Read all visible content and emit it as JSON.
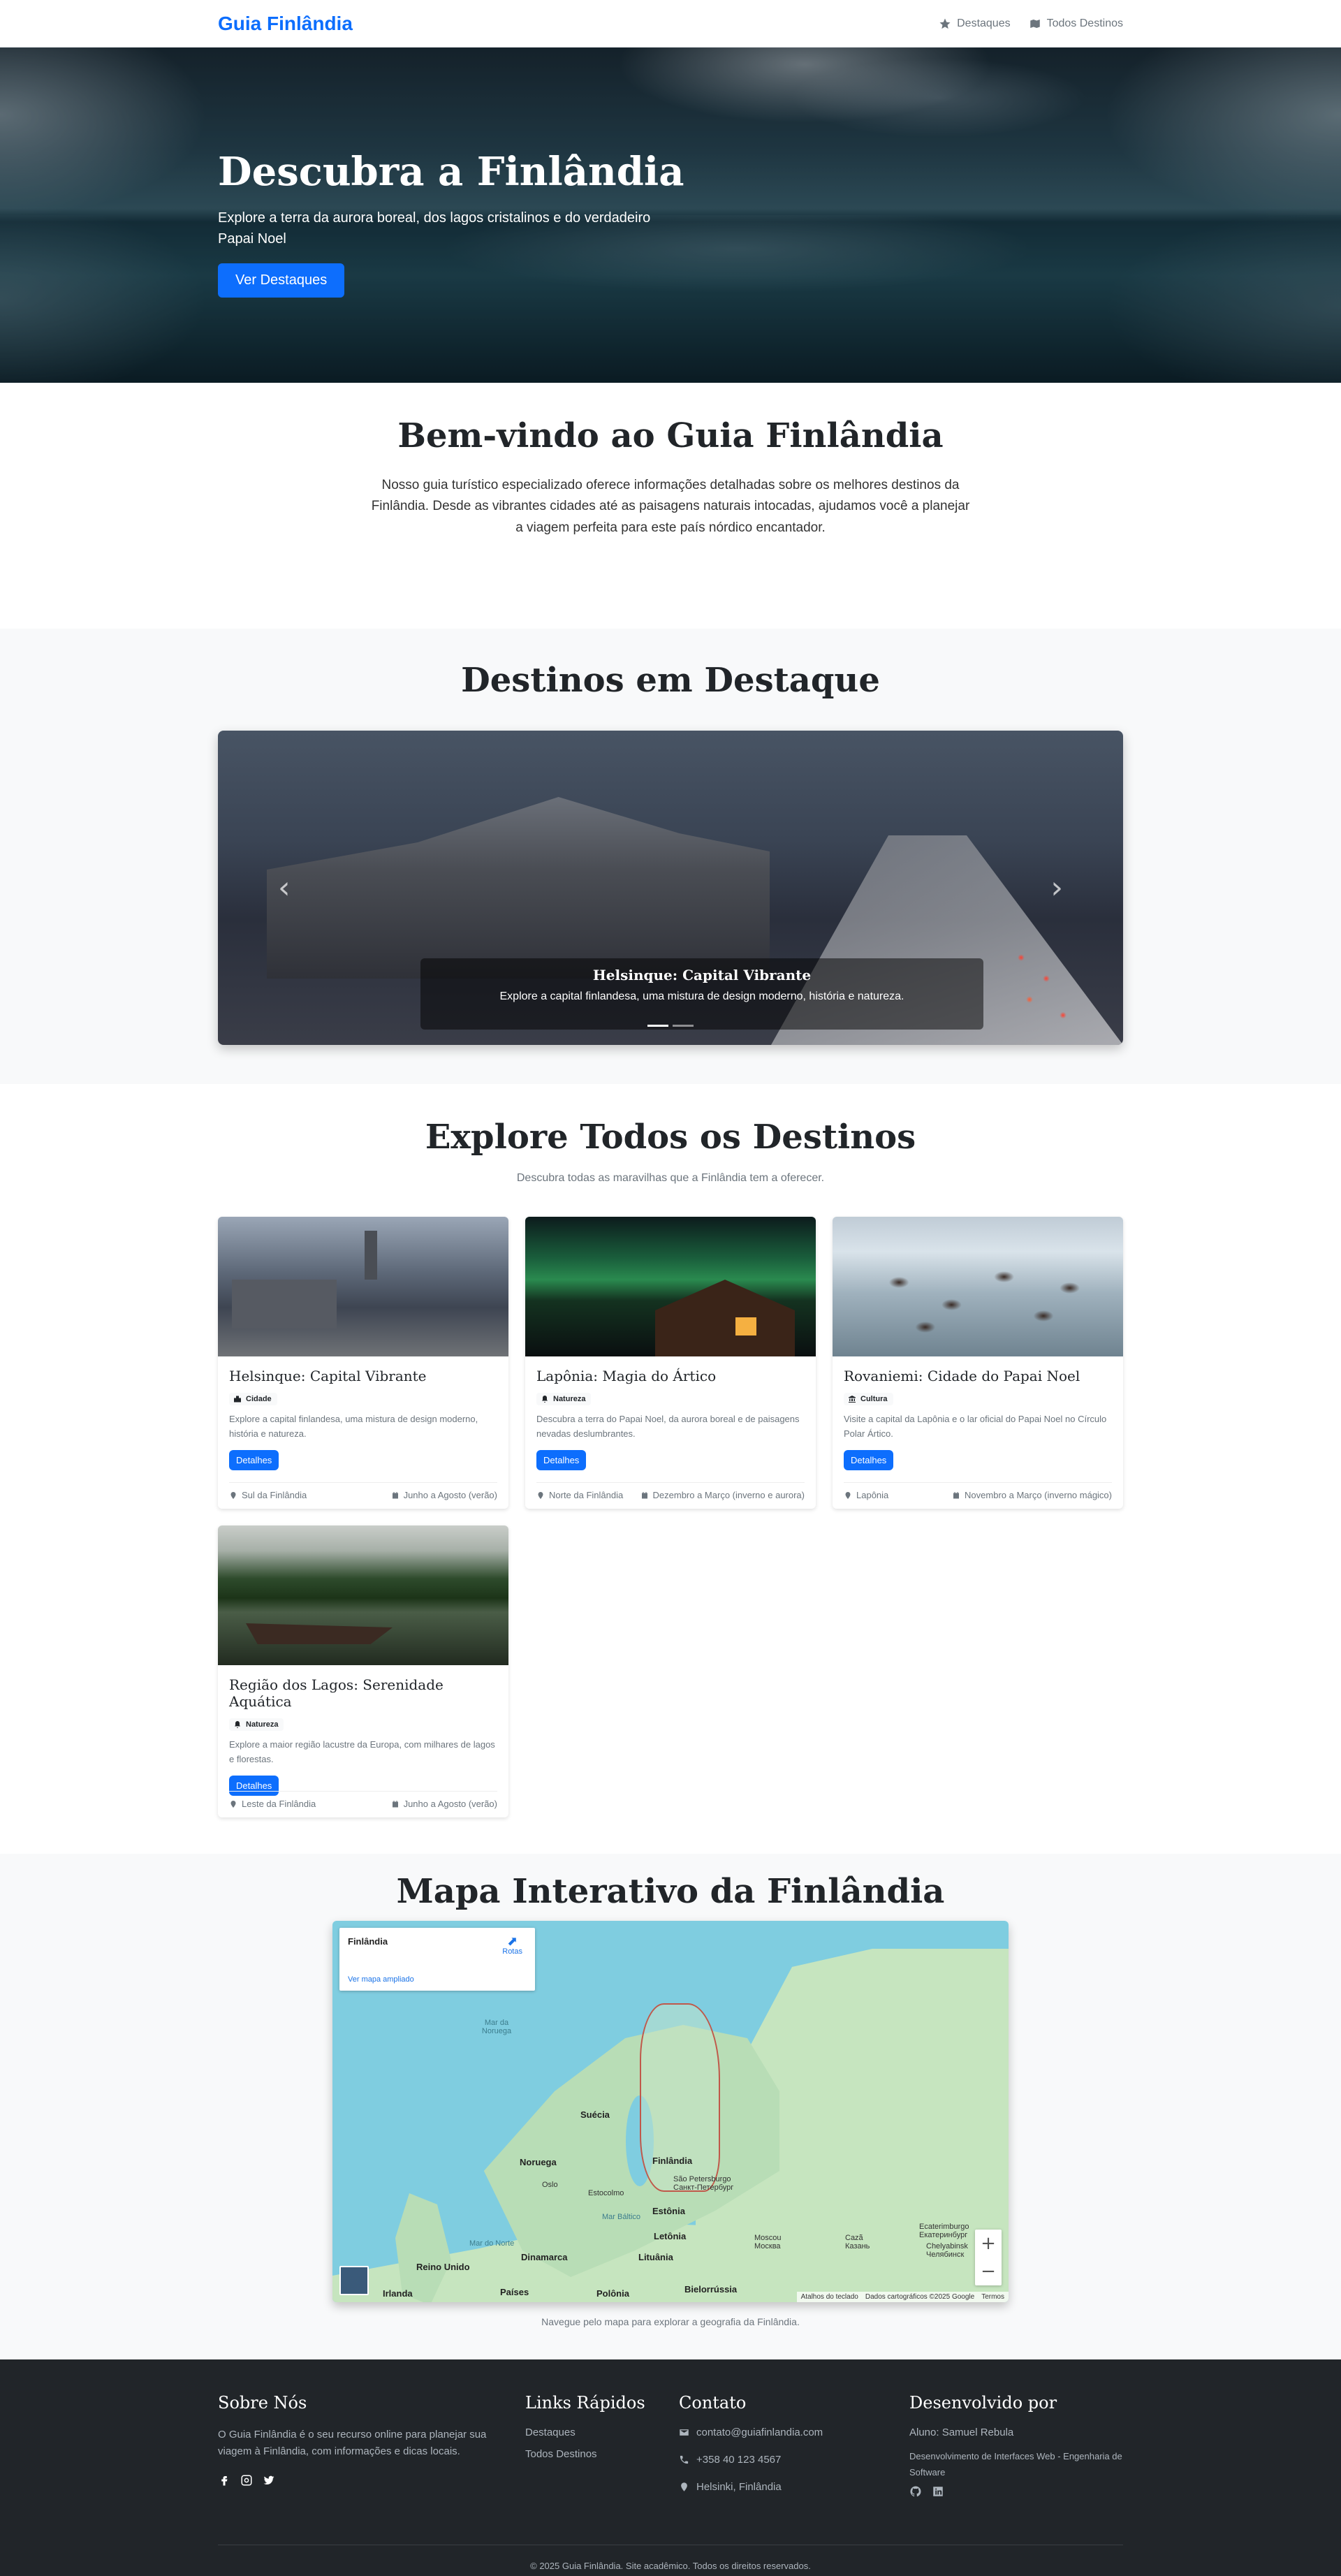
{
  "nav": {
    "brand": "Guia Finlândia",
    "links": [
      {
        "label": "Destaques",
        "icon": "star-icon"
      },
      {
        "label": "Todos Destinos",
        "icon": "map-icon"
      }
    ]
  },
  "hero": {
    "title": "Descubra a Finlândia",
    "subtitle": "Explore a terra da aurora boreal, dos lagos cristalinos e do verdadeiro Papai Noel",
    "button": "Ver Destaques"
  },
  "welcome": {
    "title": "Bem-vindo ao Guia Finlândia",
    "text": "Nosso guia turístico especializado oferece informações detalhadas sobre os melhores destinos da Finlândia. Desde as vibrantes cidades até as paisagens naturais intocadas, ajudamos você a planejar a viagem perfeita para este país nórdico encantador."
  },
  "featured": {
    "title": "Destinos em Destaque",
    "slide": {
      "title": "Helsinque: Capital Vibrante",
      "text": "Explore a capital finlandesa, uma mistura de design moderno, história e natureza."
    },
    "prev_icon": "‹",
    "next_icon": "›"
  },
  "explore": {
    "title": "Explore Todos os Destinos",
    "subtitle": "Descubra todas as maravilhas que a Finlândia tem a oferecer.",
    "cards": [
      {
        "title": "Helsinque: Capital Vibrante",
        "badge": "Cidade",
        "badge_icon": "city-icon",
        "desc": "Explore a capital finlandesa, uma mistura de design moderno, história e natureza.",
        "button": "Detalhes",
        "location": "Sul da Finlândia",
        "season": "Junho a Agosto (verão)"
      },
      {
        "title": "Lapônia: Magia do Ártico",
        "badge": "Natureza",
        "badge_icon": "bell-icon",
        "desc": "Descubra a terra do Papai Noel, da aurora boreal e de paisagens nevadas deslumbrantes.",
        "button": "Detalhes",
        "location": "Norte da Finlândia",
        "season": "Dezembro a Março (inverno e aurora)"
      },
      {
        "title": "Rovaniemi: Cidade do Papai Noel",
        "badge": "Cultura",
        "badge_icon": "landmark-icon",
        "desc": "Visite a capital da Lapônia e o lar oficial do Papai Noel no Círculo Polar Ártico.",
        "button": "Detalhes",
        "location": "Lapônia",
        "season": "Novembro a Março (inverno mágico)"
      },
      {
        "title": "Região dos Lagos: Serenidade Aquática",
        "badge": "Natureza",
        "badge_icon": "bell-icon",
        "desc": "Explore a maior região lacustre da Europa, com milhares de lagos e florestas.",
        "button": "Detalhes",
        "location": "Leste da Finlândia",
        "season": "Junho a Agosto (verão)"
      }
    ]
  },
  "map": {
    "title": "Mapa Interativo da Finlândia",
    "info_title": "Finlândia",
    "info_link": "Ver mapa ampliado",
    "routes": "Rotas",
    "labels": {
      "sea_norway": "Mar da Noruega",
      "sweden": "Suécia",
      "norway": "Noruega",
      "finland": "Finlândia",
      "oslo": "Oslo",
      "stockholm": "Estocolmo",
      "stpetersburg": "São Petersburgo Санкт-Петербург",
      "baltic": "Mar Báltico",
      "estonia": "Estônia",
      "northsea": "Mar do Norte",
      "latvia": "Letônia",
      "moscow": "Moscou Москва",
      "kazan": "Cazã Казань",
      "yekaterinburg": "Ecaterimburgo Екатеринбург",
      "chelyabinsk": "Chelyabinsk Челябинск",
      "denmark": "Dinamarca",
      "lithuania": "Lituânia",
      "uk": "Reino Unido",
      "ireland": "Irlanda",
      "netherlands": "Países",
      "poland": "Polônia",
      "belarus": "Bielorrússia"
    },
    "zoom_in": "+",
    "zoom_out": "−",
    "attribution": [
      "Atalhos do teclado",
      "Dados cartográficos ©2025 Google",
      "Termos"
    ],
    "note": "Navegue pelo mapa para explorar a geografia da Finlândia."
  },
  "footer": {
    "about_title": "Sobre Nós",
    "about_text": "O Guia Finlândia é o seu recurso online para planejar sua viagem à Finlândia, com informações e dicas locais.",
    "links_title": "Links Rápidos",
    "links": [
      "Destaques",
      "Todos Destinos"
    ],
    "contact_title": "Contato",
    "email": "contato@guiafinlandia.com",
    "phone": "+358 40 123 4567",
    "address": "Helsinki, Finlândia",
    "dev_title": "Desenvolvido por",
    "student": "Aluno: Samuel Rebula",
    "course": "Desenvolvimento de Interfaces Web - Engenharia de Software",
    "copyright": "© 2025 Guia Finlândia. Site acadêmico. Todos os direitos reservados."
  }
}
